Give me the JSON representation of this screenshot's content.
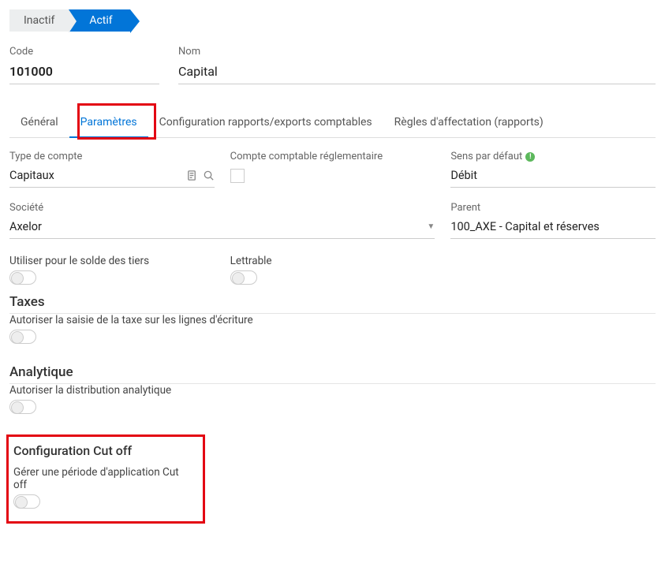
{
  "status": {
    "inactive": "Inactif",
    "active": "Actif"
  },
  "header": {
    "code_label": "Code",
    "code_value": "101000",
    "name_label": "Nom",
    "name_value": "Capital"
  },
  "tabs": {
    "general": "Général",
    "parametres": "Paramètres",
    "config_reports": "Configuration rapports/exports comptables",
    "affectation": "Règles d'affectation (rapports)"
  },
  "form": {
    "type_compte_label": "Type de compte",
    "type_compte_value": "Capitaux",
    "compte_reg_label": "Compte comptable réglementaire",
    "sens_defaut_label": "Sens par défaut",
    "sens_defaut_value": "Débit",
    "societe_label": "Société",
    "societe_value": "Axelor",
    "parent_label": "Parent",
    "parent_value": "100_AXE - Capital et réserves",
    "utiliser_solde_label": "Utiliser pour le solde des tiers",
    "lettrable_label": "Lettrable"
  },
  "taxes": {
    "title": "Taxes",
    "autoriser_label": "Autoriser la saisie de la taxe sur les lignes d'écriture"
  },
  "analytique": {
    "title": "Analytique",
    "autoriser_label": "Autoriser la distribution analytique"
  },
  "cutoff": {
    "title": "Configuration Cut off",
    "gerer_label": "Gérer une période d'application Cut off"
  }
}
